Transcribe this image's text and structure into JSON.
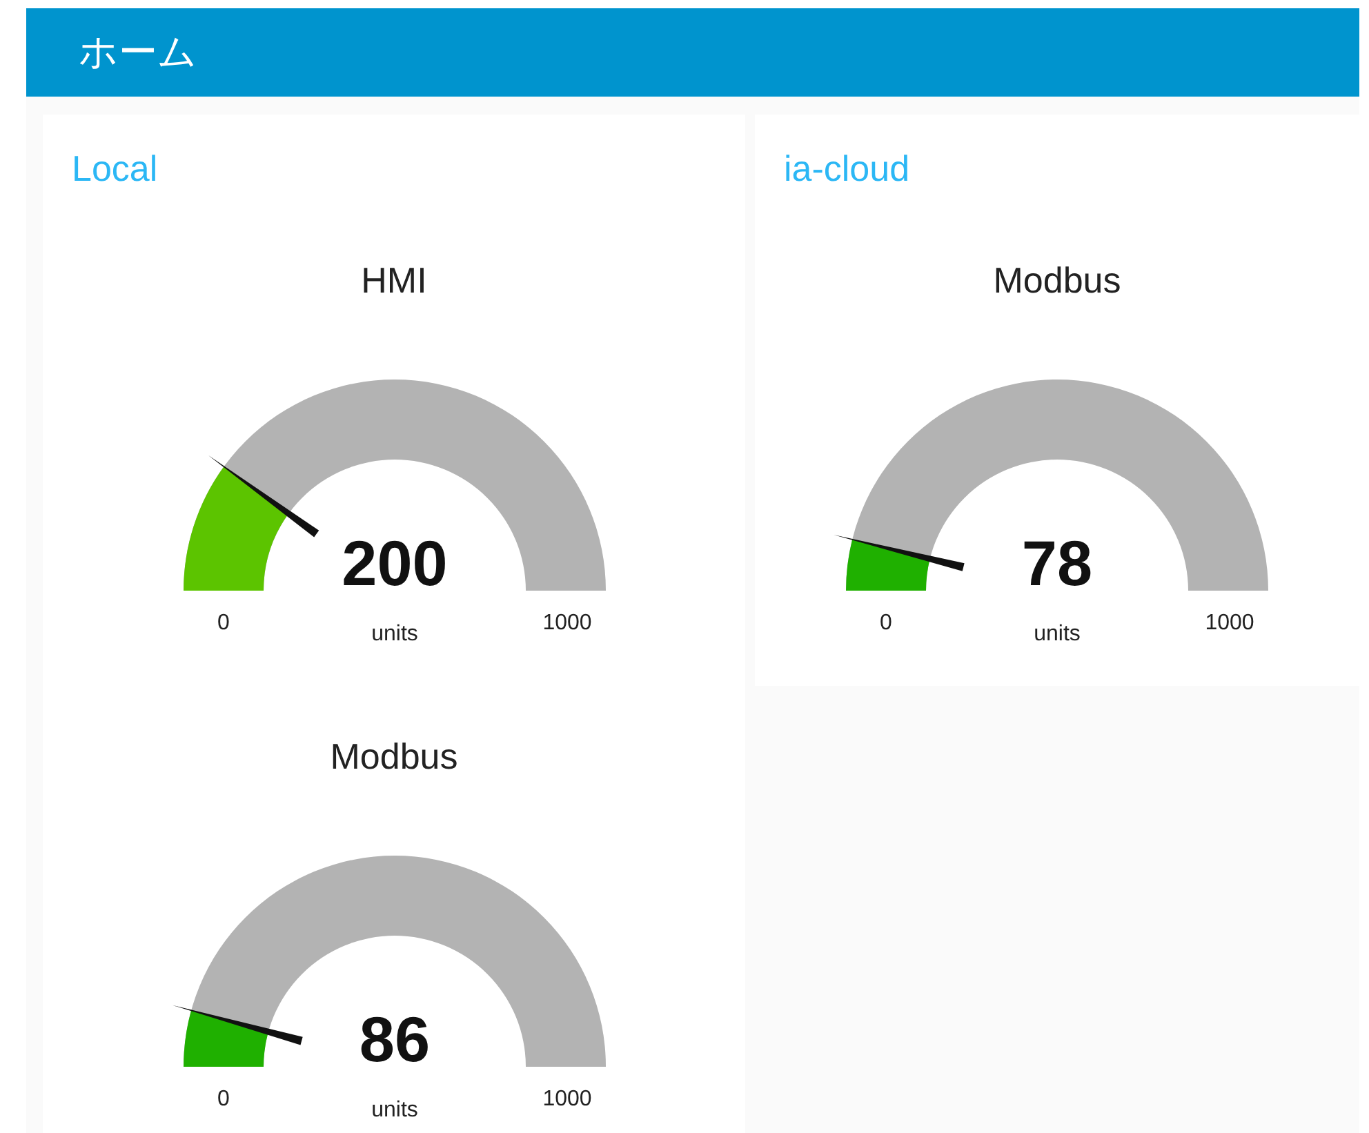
{
  "header": {
    "title": "ホーム"
  },
  "groups": [
    {
      "title": "Local",
      "gauges": [
        {
          "title": "HMI",
          "value": "200",
          "units": "units",
          "min": "0",
          "max": "1000",
          "level": 0.2,
          "color": "#5cc400"
        },
        {
          "title": "Modbus",
          "value": "86",
          "units": "units",
          "min": "0",
          "max": "1000",
          "level": 0.086,
          "color": "#1fb000"
        }
      ]
    },
    {
      "title": "ia-cloud",
      "gauges": [
        {
          "title": "Modbus",
          "value": "78",
          "units": "units",
          "min": "0",
          "max": "1000",
          "level": 0.078,
          "color": "#1fb000"
        }
      ]
    }
  ]
}
